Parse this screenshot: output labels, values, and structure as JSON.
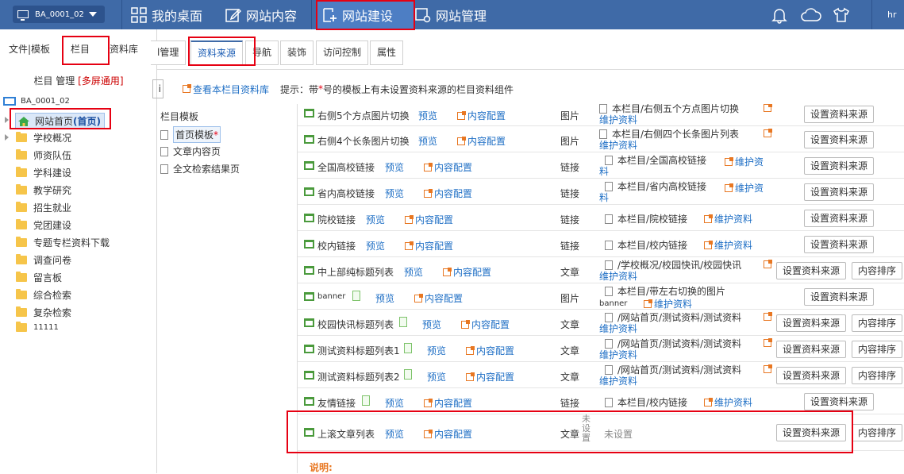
{
  "header": {
    "site_selector": "BA_0001_02",
    "nav": [
      "我的桌面",
      "网站内容",
      "网站建设",
      "网站管理"
    ],
    "user": "hr"
  },
  "left": {
    "tabs": [
      "文件|模板",
      "栏目",
      "资料库"
    ],
    "title_prefix": "栏目 管理",
    "title_highlight": "[多屏通用]",
    "tree_root": "BA_0001_02",
    "home_node": "网站首页",
    "home_node_tag": "(首页)",
    "columns": [
      "学校概况",
      "师资队伍",
      "学科建设",
      "教学研究",
      "招生就业",
      "党团建设",
      "专题专栏资料下载",
      "调查问卷",
      "留言板",
      "综合检索",
      "复杂检索",
      "11111"
    ]
  },
  "subtabs": [
    "l管理",
    "资料来源",
    "导航",
    "装饰",
    "访问控制",
    "属性"
  ],
  "info": {
    "cut_button": "i",
    "view_link": "查看本栏目资料库",
    "hint_prefix": "提示：带",
    "hint_star": "*",
    "hint_suffix": "号的模板上有未设置资料来源的栏目资料组件"
  },
  "templates": {
    "header": "栏目模板",
    "items": [
      "首页模板",
      "文章内容页",
      "全文检索结果页"
    ],
    "star": "*"
  },
  "labels": {
    "preview": "预览",
    "config": "内容配置",
    "set_source": "设置资料来源",
    "sort": "内容排序",
    "maintain": "维护资料",
    "unset": "未设置",
    "unset_v": "未设置"
  },
  "rows": [
    {
      "name": "右侧5个方点图片切换",
      "type": "图片",
      "src1": "本栏目/右侧五个方点图片切换",
      "src2": "维护资料"
    },
    {
      "name": "右侧4个长条图片切换",
      "type": "图片",
      "src1": "本栏目/右侧四个长条图片列表",
      "src2": "维护资料"
    },
    {
      "name": "全国高校链接",
      "type": "链接",
      "src1": "本栏目/全国高校链接",
      "src2": "维护资",
      "src3": "料"
    },
    {
      "name": "省内高校链接",
      "type": "链接",
      "src1": "本栏目/省内高校链接",
      "src2": "维护资",
      "src3": "料"
    },
    {
      "name": "院校链接",
      "type": "链接",
      "src1": "本栏目/院校链接",
      "src2": "维护资料"
    },
    {
      "name": "校内链接",
      "type": "链接",
      "src1": "本栏目/校内链接",
      "src2": "维护资料"
    },
    {
      "name": "中上部纯标题列表",
      "type": "文章",
      "src1": "/学校概况/校园快讯/校园快讯",
      "src2": "维护资料"
    },
    {
      "name": "banner",
      "type": "图片",
      "src1": "本栏目/带左右切换的图片",
      "src0": "banner",
      "src2": "维护资料"
    },
    {
      "name": "校园快讯标题列表",
      "type": "文章",
      "src1": "/网站首页/测试资料/测试资料",
      "src2": "维护资料"
    },
    {
      "name": "测试资料标题列表1",
      "type": "文章",
      "src1": "/网站首页/测试资料/测试资料",
      "src2": "维护资料"
    },
    {
      "name": "测试资料标题列表2",
      "type": "文章",
      "src1": "/网站首页/测试资料/测试资料",
      "src2": "维护资料"
    },
    {
      "name": "友情链接",
      "type": "链接",
      "src1": "本栏目/校内链接",
      "src2": "维护资料"
    },
    {
      "name": "上滚文章列表",
      "type": "文章"
    }
  ],
  "note": "说明:"
}
